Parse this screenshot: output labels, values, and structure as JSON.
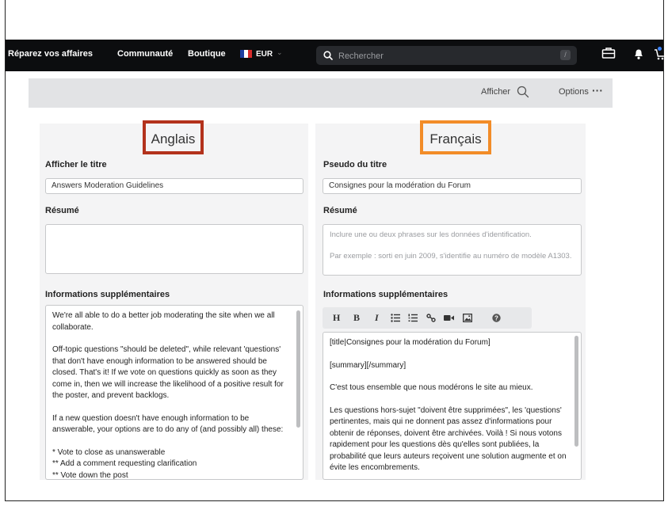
{
  "nav": {
    "links": [
      "Réparez vos affaires",
      "Communauté",
      "Boutique"
    ],
    "currency": "EUR",
    "search_placeholder": "Rechercher",
    "search_shortcut": "/",
    "icons": [
      "toolbox-icon",
      "bell-icon",
      "cart-icon"
    ],
    "notification_color": "#3b82f6"
  },
  "toolbar": {
    "view_label": "Afficher",
    "options_label": "Options"
  },
  "left": {
    "language": "Anglais",
    "highlight_color": "#b3321c",
    "title_label": "Afficher le titre",
    "title_value": "Answers Moderation Guidelines",
    "summary_label": "Résumé",
    "info_label": "Informations supplémentaires",
    "info_paragraphs": [
      "We're all able to do a better job moderating the site when we all collaborate.",
      "Off-topic questions \"should be deleted\", while relevant 'questions' that don't have enough information to be answered should be closed. That's it! If we vote on questions quickly as soon as they come in, then we will increase the likelihood of a positive result for the poster, and prevent backlogs.",
      "If a new question doesn't have enough information to be answerable, your options are to do any of (and possibly all) these:"
    ],
    "info_list": [
      "* Vote to close as unanswerable",
      "** Add a comment requesting clarification",
      "** Vote down the post"
    ]
  },
  "right": {
    "language": "Français",
    "highlight_color": "#f28c28",
    "title_label": "Pseudo du titre",
    "title_value": "Consignes pour la modération du Forum",
    "summary_label": "Résumé",
    "summary_placeholder_1": "Inclure une ou deux phrases sur les données d'identification.",
    "summary_placeholder_2": "Par exemple : sorti en juin 2009, s'identifie au numéro de modèle A1303.",
    "info_label": "Informations supplémentaires",
    "editor_buttons": [
      "H",
      "B",
      "I"
    ],
    "info_paragraphs": [
      "[title|Consignes pour la modération du Forum]",
      "[summary][/summary]",
      "C'est tous ensemble que nous modérons le site au mieux.",
      "Les questions hors-sujet \"doivent être supprimées\", les 'questions' pertinentes, mais qui ne donnent pas assez d'informations pour obtenir de réponses, doivent être archivées. Voilà ! Si nous votons rapidement pour les questions dès qu'elles sont publiées, la probabilité que leurs auteurs reçoivent une solution augmente et on évite les encombrements."
    ]
  }
}
